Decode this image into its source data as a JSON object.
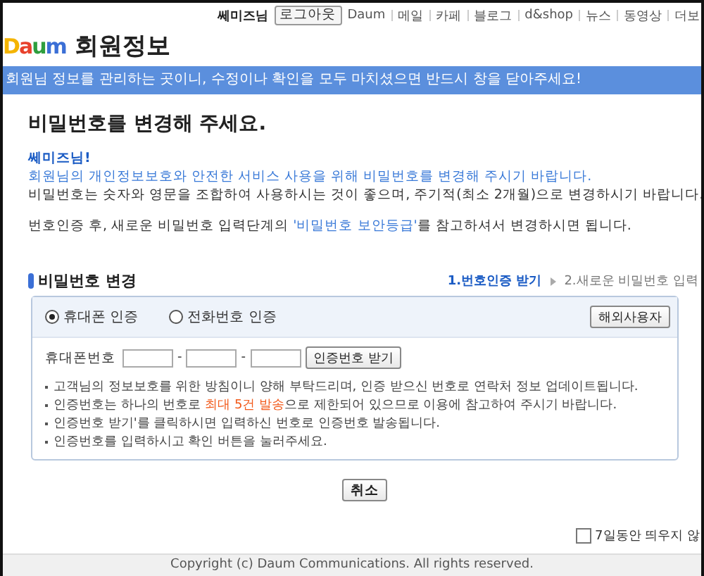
{
  "top_nav": {
    "user": "쎄미즈님",
    "logout": "로그아웃",
    "links": [
      "Daum",
      "메일",
      "카페",
      "블로그",
      "d&shop",
      "뉴스",
      "동영상",
      "더보"
    ]
  },
  "header": {
    "logo": "Daum",
    "title": "회원정보"
  },
  "notice_bar": "회원님 정보를 관리하는 곳이니, 수정이나 확인을 모두 마치셨으면 반드시 창을 닫아주세요!",
  "heading": "비밀번호를 변경해 주세요.",
  "greeting": "쎄미즈님!",
  "intro": "회원님의 개인정보보호와 안전한 서비스 사용을 위해 비밀번호를 변경해 주시기 바랍니다.",
  "advice": "비밀번호는 숫자와 영문을 조합하여 사용하시는 것이 좋으며, 주기적(최소 2개월)으로 변경하시기 바랍니다.",
  "guide": {
    "before": "번호인증 후, 새로운 비밀번호 입력단계의 ",
    "link": "'비밀번호 보안등급'",
    "after": "를 참고하셔서 변경하시면 됩니다."
  },
  "section": {
    "title": "비밀번호 변경",
    "steps": [
      {
        "label": "1.번호인증 받기",
        "selected": true
      },
      {
        "label": "2.새로운 비밀번호 입력",
        "selected": false
      }
    ],
    "methods": [
      {
        "label": "휴대폰 인증",
        "selected": true
      },
      {
        "label": "전화번호 인증",
        "selected": false
      }
    ],
    "overseas_button": "해외사용자",
    "phone_label": "휴대폰번호",
    "separators": [
      "-",
      "-"
    ],
    "request_button": "인증번호 받기",
    "notes": [
      {
        "before": "고객님의 정보보호를 위한 방침이니 양해 부탁드리며, 인증 받으신 번호로 연락처 정보 업데이트됩니다."
      },
      {
        "before": "인증번호는 하나의 번호로 ",
        "highlight": "최대 5건 발송",
        "after": "으로 제한되어 있으므로 이용에 참고하여 주시기 바랍니다."
      },
      {
        "before": "인증번호 받기'를 클릭하시면 입력하신 번호로 인증번호 발송됩니다."
      },
      {
        "before": "인증번호를 입력하시고 확인 버튼을 눌러주세요."
      }
    ]
  },
  "cancel_button": "취소",
  "hide_option": {
    "label": "7일동안 띄우지 않",
    "checked": false
  },
  "footer": "Copyright (c) Daum Communications. All rights reserved."
}
